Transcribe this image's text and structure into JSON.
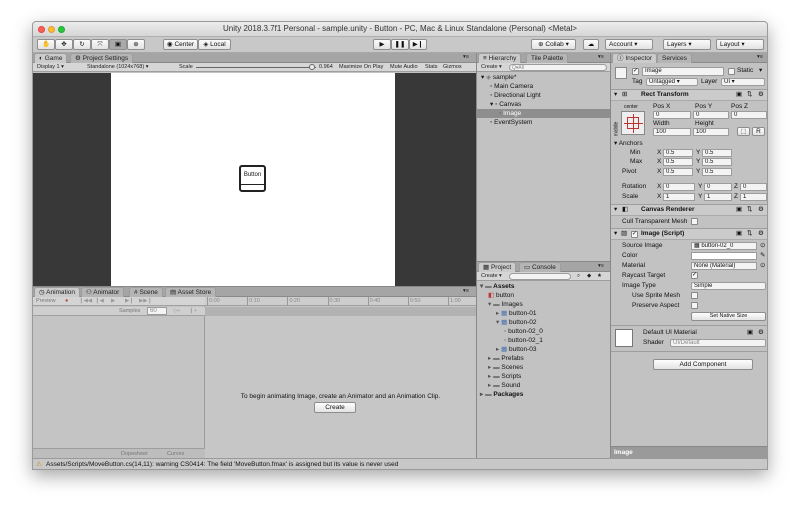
{
  "window": {
    "title": "Unity 2018.3.7f1 Personal - sample.unity - Button - PC, Mac & Linux Standalone (Personal) <Metal>"
  },
  "toolbar": {
    "center_label": "Center",
    "local_label": "Local",
    "collab_label": "Collab",
    "account_label": "Account",
    "layers_label": "Layers",
    "layout_label": "Layout"
  },
  "game_panel": {
    "tabs": [
      "Game",
      "Project Settings"
    ],
    "display": "Display 1",
    "resolution": "Standalone (1024x768)",
    "scale_label": "Scale",
    "scale_value": "0.964",
    "scale_fraction": 0.964,
    "maximize": "Maximize On Play",
    "mute": "Mute Audio",
    "stats": "Stats",
    "gizmos": "Gizmos",
    "button_text": "Button"
  },
  "hierarchy": {
    "tabs": [
      "Hierarchy",
      "Tile Palette"
    ],
    "create": "Create",
    "search": "Q▾All",
    "items": [
      {
        "label": "sample*",
        "depth": 0
      },
      {
        "label": "Main Camera",
        "depth": 1
      },
      {
        "label": "Directional Light",
        "depth": 1
      },
      {
        "label": "Canvas",
        "depth": 1
      },
      {
        "label": "Image",
        "depth": 2
      },
      {
        "label": "EventSystem",
        "depth": 1
      }
    ]
  },
  "project": {
    "tabs": [
      "Project",
      "Console"
    ],
    "create": "Create",
    "items": [
      {
        "label": "Assets",
        "depth": 0,
        "icon": "folder"
      },
      {
        "label": "button",
        "depth": 1,
        "icon": "scene"
      },
      {
        "label": "Images",
        "depth": 1,
        "icon": "folder"
      },
      {
        "label": "button-01",
        "depth": 2,
        "icon": "sprite"
      },
      {
        "label": "button-02",
        "depth": 2,
        "icon": "sprite"
      },
      {
        "label": "button-02_0",
        "depth": 3,
        "icon": "sprite-slice"
      },
      {
        "label": "button-02_1",
        "depth": 3,
        "icon": "sprite-slice"
      },
      {
        "label": "button-03",
        "depth": 2,
        "icon": "sprite"
      },
      {
        "label": "Prefabs",
        "depth": 1,
        "icon": "folder"
      },
      {
        "label": "Scenes",
        "depth": 1,
        "icon": "folder"
      },
      {
        "label": "Scripts",
        "depth": 1,
        "icon": "folder"
      },
      {
        "label": "Sound",
        "depth": 1,
        "icon": "folder"
      },
      {
        "label": "Packages",
        "depth": 0,
        "icon": "folder"
      }
    ]
  },
  "animation": {
    "tabs": [
      "Animation",
      "Animator",
      "Scene",
      "Asset Store"
    ],
    "preview": "Preview",
    "samples_label": "Samples",
    "samples_value": "60",
    "ticks": [
      "0:00",
      "0:10",
      "0:20",
      "0:30",
      "0:40",
      "0:50",
      "1:00"
    ],
    "message": "To begin animating Image, create an Animator and an Animation Clip.",
    "create_button": "Create",
    "dopesheet": "Dopesheet",
    "curves": "Curves"
  },
  "inspector": {
    "tabs": [
      "Inspector",
      "Services"
    ],
    "object_name": "Image",
    "static_label": "Static",
    "tag_label": "Tag",
    "tag_value": "Untagged",
    "layer_label": "Layer",
    "layer_value": "UI",
    "rect_transform": {
      "title": "Rect Transform",
      "anchor_h": "center",
      "anchor_v": "middle",
      "pos_x_label": "Pos X",
      "pos_y_label": "Pos Y",
      "pos_z_label": "Pos Z",
      "pos_x": "0",
      "pos_y": "0",
      "pos_z": "0",
      "width_label": "Width",
      "height_label": "Height",
      "width": "100",
      "height": "100",
      "anchors_label": "Anchors",
      "min_label": "Min",
      "max_label": "Max",
      "pivot_label": "Pivot",
      "min_x": "0.5",
      "min_y": "0.5",
      "max_x": "0.5",
      "max_y": "0.5",
      "pivot_x": "0.5",
      "pivot_y": "0.5",
      "rotation_label": "Rotation",
      "scale_label": "Scale",
      "rot_x": "0",
      "rot_y": "0",
      "rot_z": "0",
      "scale_x": "1",
      "scale_y": "1",
      "scale_z": "1",
      "r_button": "R"
    },
    "canvas_renderer": {
      "title": "Canvas Renderer",
      "cull_label": "Cull Transparent Mesh"
    },
    "image_script": {
      "title": "Image (Script)",
      "source_label": "Source Image",
      "source_value": "button-02_0",
      "color_label": "Color",
      "material_label": "Material",
      "material_value": "None (Material)",
      "raycast_label": "Raycast Target",
      "image_type_label": "Image Type",
      "image_type_value": "Simple",
      "use_sprite_mesh_label": "Use Sprite Mesh",
      "preserve_aspect_label": "Preserve Aspect",
      "native_size_button": "Set Native Size"
    },
    "material": {
      "title": "Default UI Material",
      "shader_label": "Shader",
      "shader_value": "UI/Default"
    },
    "add_component": "Add Component",
    "footer": "Image"
  },
  "status_bar": {
    "message": "Assets/Scripts/MoveButton.cs(14,11): warning CS0414: The field 'MoveButton.fmax' is assigned but its value is never used"
  },
  "colors": {
    "panel_bg": "#c2c2c2",
    "selection": "#8e8e8e",
    "game_backdrop": "#383838",
    "warning": "#f2c200"
  }
}
